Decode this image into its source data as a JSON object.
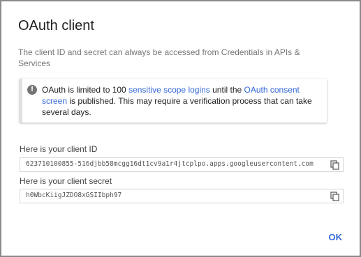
{
  "dialog": {
    "title": "OAuth client",
    "description": "The client ID and secret can always be accessed from Credentials in APIs & Services",
    "notice": {
      "icon": "info-icon",
      "text_before": "OAuth is limited to 100 ",
      "link1": "sensitive scope logins",
      "text_middle": " until the ",
      "link2": "OAuth consent screen",
      "text_after": " is published. This may require a verification process that can take several days."
    },
    "client_id": {
      "label": "Here is your client ID",
      "value": "623710100855-516djbb58mcgg16dt1cv9a1r4jtcplpo.apps.googleusercontent.com",
      "copy_icon": "copy-icon"
    },
    "client_secret": {
      "label": "Here is your client secret",
      "value": "h0WbcKiigJZDO8xGSIIbph97",
      "copy_icon": "copy-icon"
    },
    "ok_label": "OK"
  },
  "colors": {
    "link": "#3367d6",
    "title": "#212121",
    "muted": "#757575"
  }
}
